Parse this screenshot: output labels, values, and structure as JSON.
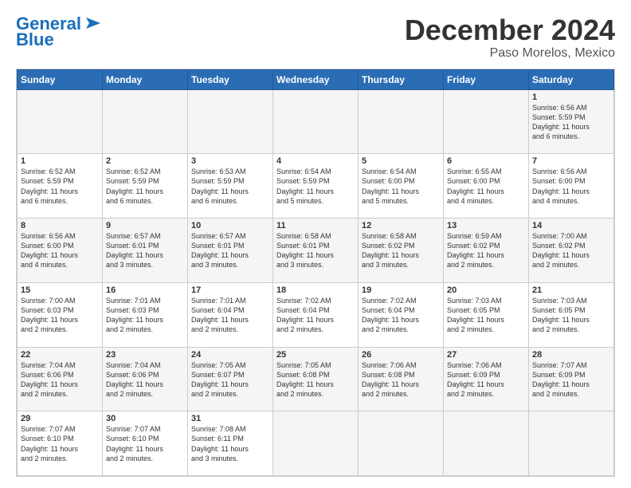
{
  "header": {
    "logo_line1": "General",
    "logo_line2": "Blue",
    "title": "December 2024",
    "subtitle": "Paso Morelos, Mexico"
  },
  "calendar": {
    "days_of_week": [
      "Sunday",
      "Monday",
      "Tuesday",
      "Wednesday",
      "Thursday",
      "Friday",
      "Saturday"
    ],
    "weeks": [
      [
        {
          "day": "",
          "info": ""
        },
        {
          "day": "",
          "info": ""
        },
        {
          "day": "",
          "info": ""
        },
        {
          "day": "",
          "info": ""
        },
        {
          "day": "",
          "info": ""
        },
        {
          "day": "",
          "info": ""
        },
        {
          "day": "1",
          "info": "Sunrise: 6:56 AM\nSunset: 5:59 PM\nDaylight: 11 hours\nand 6 minutes."
        }
      ],
      [
        {
          "day": "1",
          "info": "Sunrise: 6:52 AM\nSunset: 5:59 PM\nDaylight: 11 hours\nand 6 minutes."
        },
        {
          "day": "2",
          "info": "Sunrise: 6:52 AM\nSunset: 5:59 PM\nDaylight: 11 hours\nand 6 minutes."
        },
        {
          "day": "3",
          "info": "Sunrise: 6:53 AM\nSunset: 5:59 PM\nDaylight: 11 hours\nand 6 minutes."
        },
        {
          "day": "4",
          "info": "Sunrise: 6:54 AM\nSunset: 5:59 PM\nDaylight: 11 hours\nand 5 minutes."
        },
        {
          "day": "5",
          "info": "Sunrise: 6:54 AM\nSunset: 6:00 PM\nDaylight: 11 hours\nand 5 minutes."
        },
        {
          "day": "6",
          "info": "Sunrise: 6:55 AM\nSunset: 6:00 PM\nDaylight: 11 hours\nand 4 minutes."
        },
        {
          "day": "7",
          "info": "Sunrise: 6:56 AM\nSunset: 6:00 PM\nDaylight: 11 hours\nand 4 minutes."
        }
      ],
      [
        {
          "day": "8",
          "info": "Sunrise: 6:56 AM\nSunset: 6:00 PM\nDaylight: 11 hours\nand 4 minutes."
        },
        {
          "day": "9",
          "info": "Sunrise: 6:57 AM\nSunset: 6:01 PM\nDaylight: 11 hours\nand 3 minutes."
        },
        {
          "day": "10",
          "info": "Sunrise: 6:57 AM\nSunset: 6:01 PM\nDaylight: 11 hours\nand 3 minutes."
        },
        {
          "day": "11",
          "info": "Sunrise: 6:58 AM\nSunset: 6:01 PM\nDaylight: 11 hours\nand 3 minutes."
        },
        {
          "day": "12",
          "info": "Sunrise: 6:58 AM\nSunset: 6:02 PM\nDaylight: 11 hours\nand 3 minutes."
        },
        {
          "day": "13",
          "info": "Sunrise: 6:59 AM\nSunset: 6:02 PM\nDaylight: 11 hours\nand 2 minutes."
        },
        {
          "day": "14",
          "info": "Sunrise: 7:00 AM\nSunset: 6:02 PM\nDaylight: 11 hours\nand 2 minutes."
        }
      ],
      [
        {
          "day": "15",
          "info": "Sunrise: 7:00 AM\nSunset: 6:03 PM\nDaylight: 11 hours\nand 2 minutes."
        },
        {
          "day": "16",
          "info": "Sunrise: 7:01 AM\nSunset: 6:03 PM\nDaylight: 11 hours\nand 2 minutes."
        },
        {
          "day": "17",
          "info": "Sunrise: 7:01 AM\nSunset: 6:04 PM\nDaylight: 11 hours\nand 2 minutes."
        },
        {
          "day": "18",
          "info": "Sunrise: 7:02 AM\nSunset: 6:04 PM\nDaylight: 11 hours\nand 2 minutes."
        },
        {
          "day": "19",
          "info": "Sunrise: 7:02 AM\nSunset: 6:04 PM\nDaylight: 11 hours\nand 2 minutes."
        },
        {
          "day": "20",
          "info": "Sunrise: 7:03 AM\nSunset: 6:05 PM\nDaylight: 11 hours\nand 2 minutes."
        },
        {
          "day": "21",
          "info": "Sunrise: 7:03 AM\nSunset: 6:05 PM\nDaylight: 11 hours\nand 2 minutes."
        }
      ],
      [
        {
          "day": "22",
          "info": "Sunrise: 7:04 AM\nSunset: 6:06 PM\nDaylight: 11 hours\nand 2 minutes."
        },
        {
          "day": "23",
          "info": "Sunrise: 7:04 AM\nSunset: 6:06 PM\nDaylight: 11 hours\nand 2 minutes."
        },
        {
          "day": "24",
          "info": "Sunrise: 7:05 AM\nSunset: 6:07 PM\nDaylight: 11 hours\nand 2 minutes."
        },
        {
          "day": "25",
          "info": "Sunrise: 7:05 AM\nSunset: 6:08 PM\nDaylight: 11 hours\nand 2 minutes."
        },
        {
          "day": "26",
          "info": "Sunrise: 7:06 AM\nSunset: 6:08 PM\nDaylight: 11 hours\nand 2 minutes."
        },
        {
          "day": "27",
          "info": "Sunrise: 7:06 AM\nSunset: 6:09 PM\nDaylight: 11 hours\nand 2 minutes."
        },
        {
          "day": "28",
          "info": "Sunrise: 7:07 AM\nSunset: 6:09 PM\nDaylight: 11 hours\nand 2 minutes."
        }
      ],
      [
        {
          "day": "29",
          "info": "Sunrise: 7:07 AM\nSunset: 6:10 PM\nDaylight: 11 hours\nand 2 minutes."
        },
        {
          "day": "30",
          "info": "Sunrise: 7:07 AM\nSunset: 6:10 PM\nDaylight: 11 hours\nand 2 minutes."
        },
        {
          "day": "31",
          "info": "Sunrise: 7:08 AM\nSunset: 6:11 PM\nDaylight: 11 hours\nand 3 minutes."
        },
        {
          "day": "",
          "info": ""
        },
        {
          "day": "",
          "info": ""
        },
        {
          "day": "",
          "info": ""
        },
        {
          "day": "",
          "info": ""
        }
      ]
    ]
  }
}
